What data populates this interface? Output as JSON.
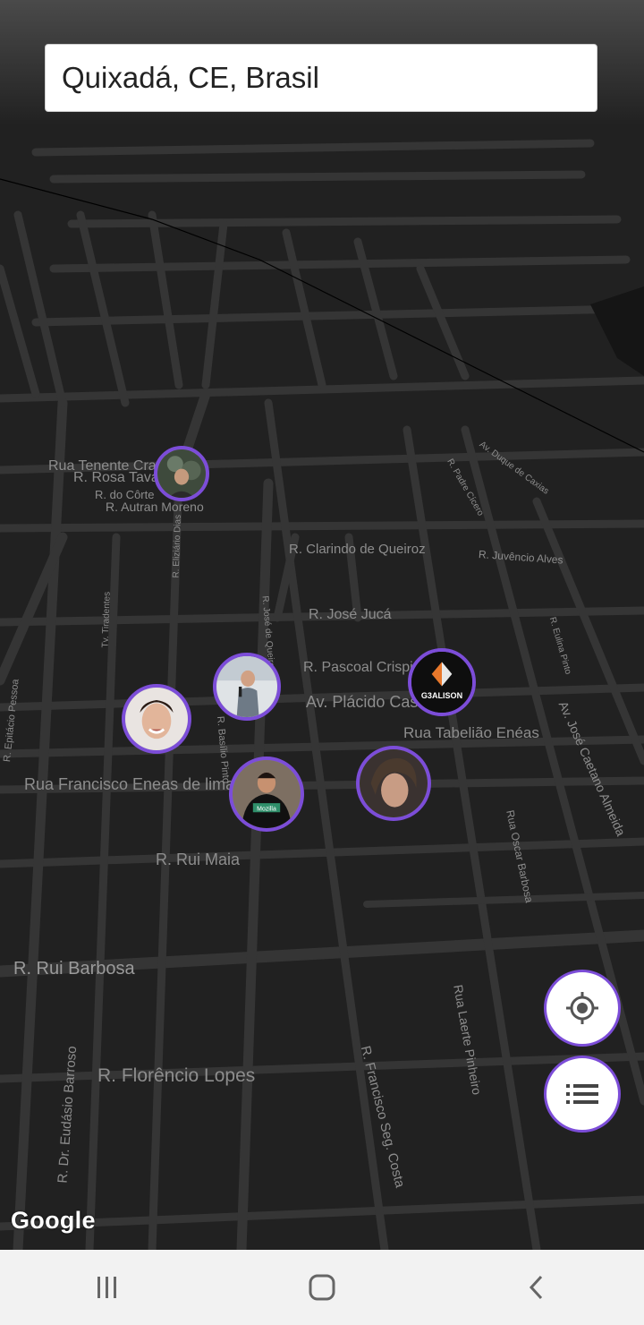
{
  "search": {
    "value": "Quixadá, CE, Brasil"
  },
  "map": {
    "attribution": "Google",
    "street_labels": [
      "Rua Tenente Cravo",
      "R. Rosa Tavares",
      "R. do Côrte",
      "R. Autran Moreno",
      "R. Clarindo de Queiroz",
      "R. Juvêncio Alves",
      "R. José Jucá",
      "R. Pascoal Crispim",
      "Av. Plácido Castelo",
      "Rua Tabelião Enéas",
      "Rua Francisco Eneas de lima",
      "R. Rui Maia",
      "R. Rui Barbosa",
      "R. Florêncio Lopes",
      "R. Dr. Eudásio Barroso",
      "R. Francisco Seg. Costa",
      "Rua Laerte Pinheiro",
      "Rua Oscar Barbosa",
      "Av. José Caetano Almeida",
      "R. Epitácio Pessoa",
      "R. Basílio Pinto",
      "R. José de Queiroz",
      "Tv. Tiradentes",
      "R. Eliziário Dias",
      "R. Eulina Pinto",
      "R. Padre Cícero",
      "Av. Duque de Caxias"
    ],
    "pins": [
      {
        "name": "user-pin-1",
        "badge": ""
      },
      {
        "name": "user-pin-2",
        "badge": ""
      },
      {
        "name": "user-pin-3",
        "badge": ""
      },
      {
        "name": "user-pin-4",
        "badge": "Mozilla"
      },
      {
        "name": "user-pin-5",
        "badge": ""
      },
      {
        "name": "user-pin-6",
        "badge": "G3ALISON"
      }
    ]
  },
  "fabs": {
    "locate_icon": "crosshair-icon",
    "list_icon": "list-icon"
  },
  "navbar": {
    "recent_icon": "recent-apps-icon",
    "home_icon": "home-icon",
    "back_icon": "back-icon"
  },
  "colors": {
    "accent": "#7c4dd8",
    "map_bg": "#212121",
    "road": "#3c3c3c",
    "label": "#8d8d8d"
  }
}
